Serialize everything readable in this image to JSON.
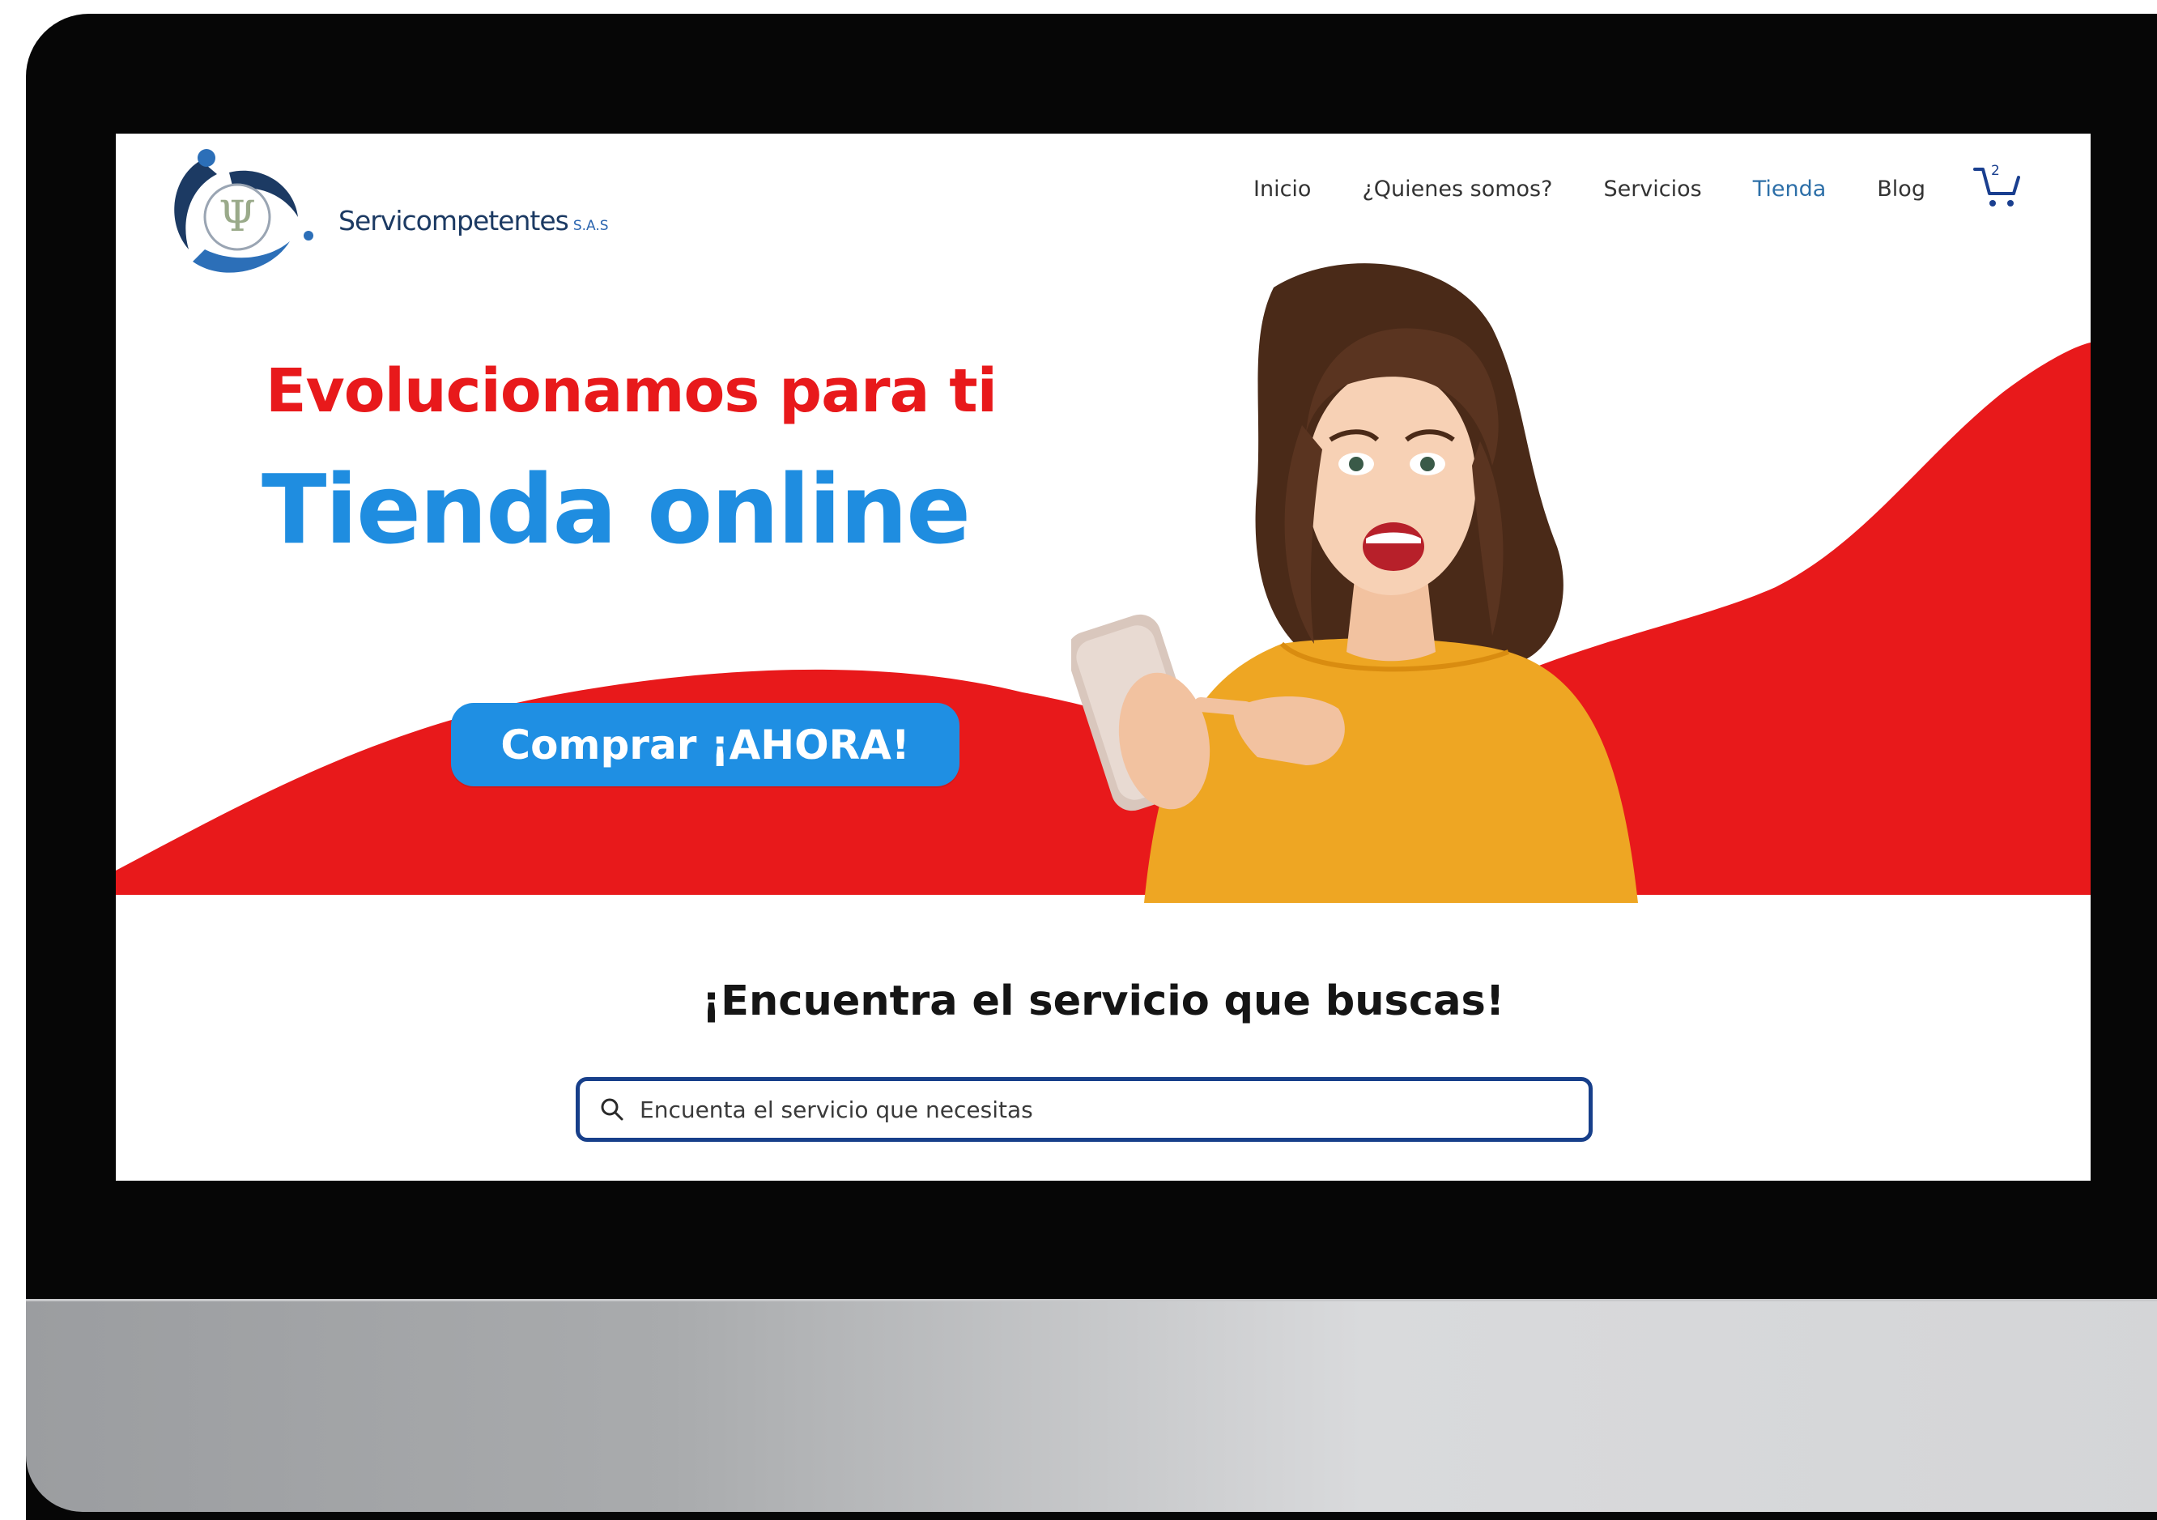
{
  "brand": {
    "name": "Servicompetentes",
    "suffix": "S.A.S",
    "colors": {
      "red": "#e8191b",
      "blue": "#1f8de0",
      "navy": "#173f8a"
    }
  },
  "nav": {
    "items": [
      {
        "label": "Inicio",
        "active": false
      },
      {
        "label": "¿Quienes somos?",
        "active": false
      },
      {
        "label": "Servicios",
        "active": false
      },
      {
        "label": "Tienda",
        "active": true
      },
      {
        "label": "Blog",
        "active": false
      }
    ],
    "cart_count": "2",
    "cart_icon": "shopping-cart-icon"
  },
  "hero": {
    "line1": "Evolucionamos para ti",
    "line2": "Tienda online",
    "cta_label": "Comprar ¡AHORA!"
  },
  "search": {
    "title": "¡Encuentra el servicio que buscas!",
    "placeholder": "Encuenta el servicio que necesitas",
    "icon": "search-icon"
  }
}
